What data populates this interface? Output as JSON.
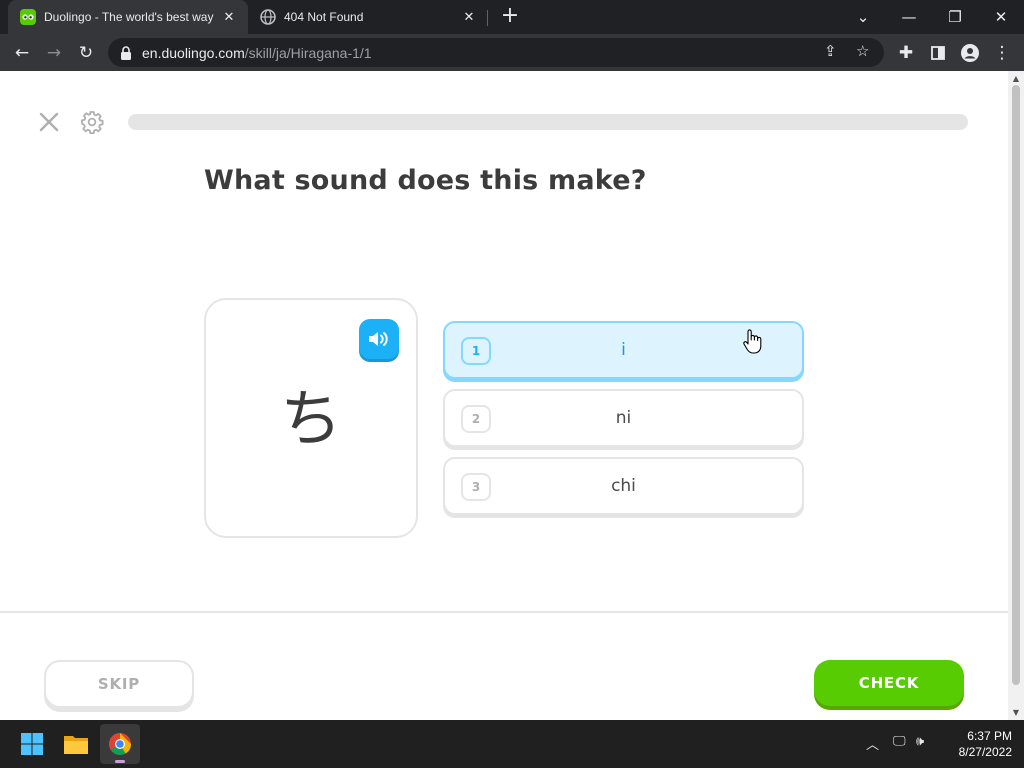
{
  "browser": {
    "tabs": [
      {
        "title": "Duolingo - The world's best way",
        "active": true
      },
      {
        "title": "404 Not Found",
        "active": false
      }
    ],
    "url_host": "en.duolingo.com",
    "url_path": "/skill/ja/Hiragana-1/1"
  },
  "lesson": {
    "progress_percent": 0,
    "question": "What sound does this make?",
    "character": "ち",
    "options": [
      {
        "number": "1",
        "label": "i",
        "selected": true
      },
      {
        "number": "2",
        "label": "ni",
        "selected": false
      },
      {
        "number": "3",
        "label": "chi",
        "selected": false
      }
    ],
    "skip_label": "SKIP",
    "check_label": "CHECK"
  },
  "colors": {
    "accent_green": "#58cc02",
    "accent_blue": "#1cb0f6",
    "selected_bg": "#ddf4ff"
  },
  "icons": {
    "close": "close-icon",
    "settings": "gear-icon",
    "audio": "speaker-icon"
  },
  "taskbar": {
    "time": "6:37 PM",
    "date": "8/27/2022"
  }
}
